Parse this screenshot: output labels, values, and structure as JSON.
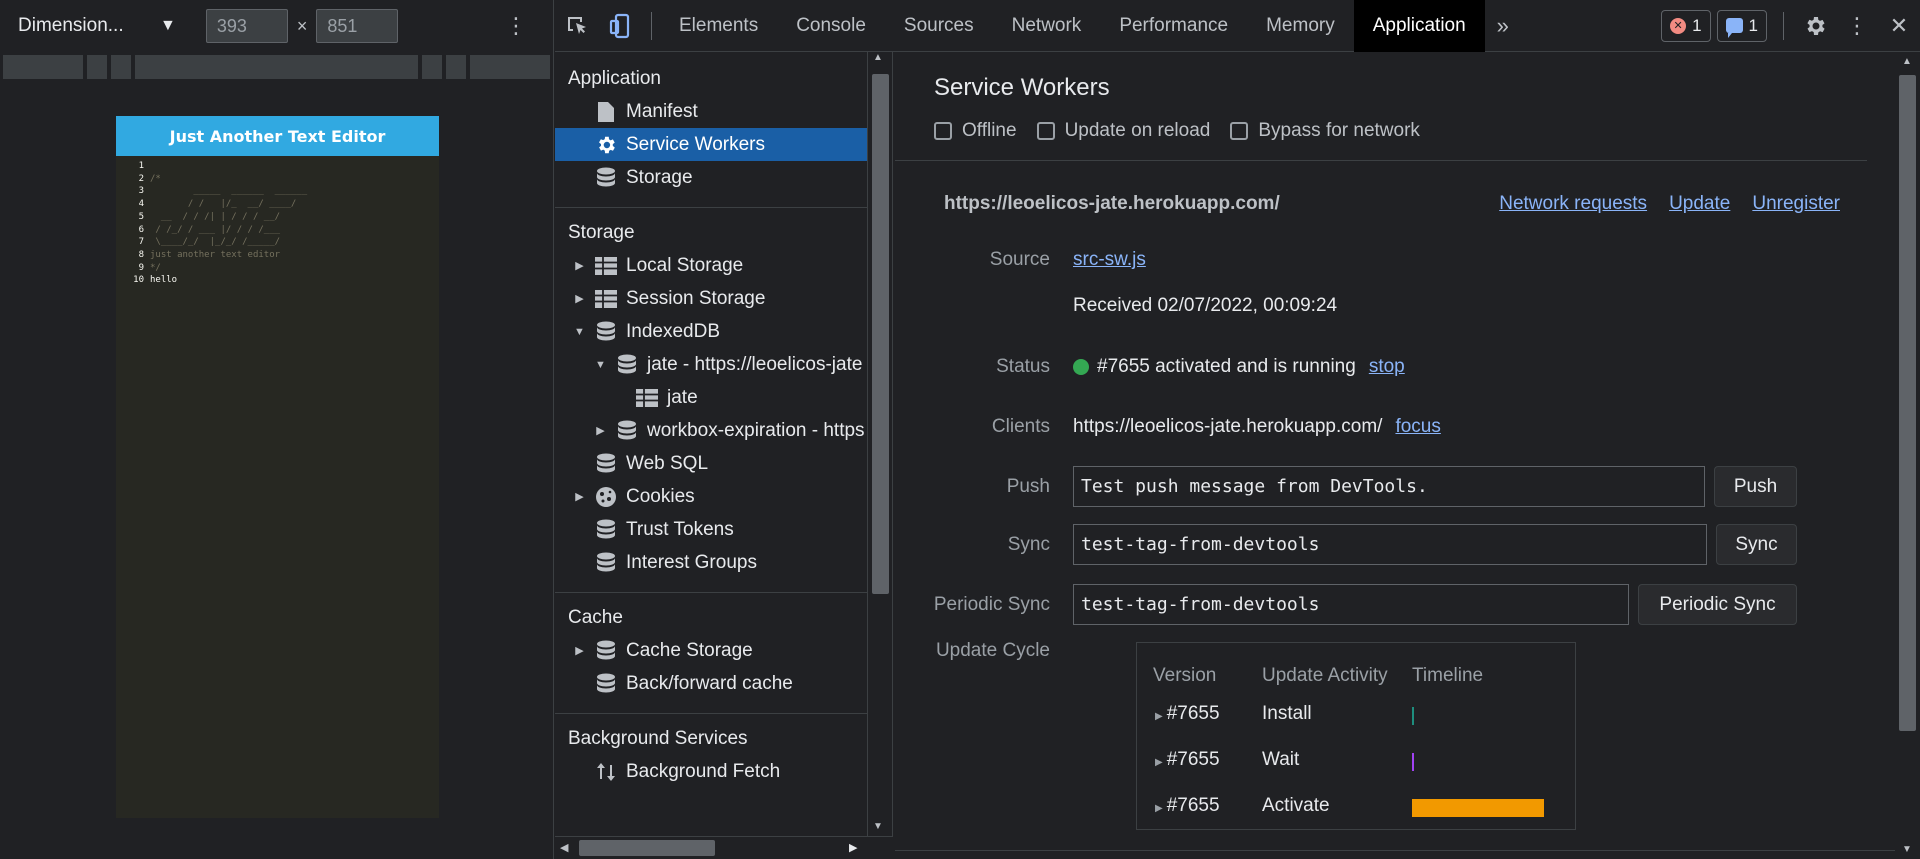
{
  "device": {
    "dimension_label": "Dimension...",
    "width": "393",
    "height": "851",
    "times": "×",
    "editor_title": "Just Another Text Editor",
    "code": [
      {
        "n": "1",
        "t": ""
      },
      {
        "n": "2",
        "t": "/*"
      },
      {
        "n": "3",
        "t": "        _____  ______  ______"
      },
      {
        "n": "4",
        "t": "       / /   |/_  __/ ____/"
      },
      {
        "n": "5",
        "t": "  __  / / /| | / / / __/"
      },
      {
        "n": "6",
        "t": " / /_/ / ___ |/ / / /___"
      },
      {
        "n": "7",
        "t": " \\____/_/  |_/_/ /_____/"
      },
      {
        "n": "8",
        "t": "just another text editor"
      },
      {
        "n": "9",
        "t": "*/"
      },
      {
        "n": "10",
        "t": "hello"
      }
    ]
  },
  "tabs": [
    "Elements",
    "Console",
    "Sources",
    "Network",
    "Performance",
    "Memory",
    "Application"
  ],
  "active_tab": "Application",
  "badges": {
    "errors": "1",
    "messages": "1"
  },
  "sidebar": {
    "application_title": "Application",
    "application_items": [
      "Manifest",
      "Service Workers",
      "Storage"
    ],
    "storage_title": "Storage",
    "storage_items": [
      "Local Storage",
      "Session Storage",
      "IndexedDB",
      "jate - https://leoelicos-jate",
      "jate",
      "workbox-expiration - https",
      "Web SQL",
      "Cookies",
      "Trust Tokens",
      "Interest Groups"
    ],
    "cache_title": "Cache",
    "cache_items": [
      "Cache Storage",
      "Back/forward cache"
    ],
    "bg_title": "Background Services",
    "bg_items": [
      "Background Fetch"
    ]
  },
  "main": {
    "title": "Service Workers",
    "options": [
      "Offline",
      "Update on reload",
      "Bypass for network"
    ],
    "sw_url": "https://leoelicos-jate.herokuapp.com/",
    "links": [
      "Network requests",
      "Update",
      "Unregister"
    ],
    "source_label": "Source",
    "source_link": "src-sw.js",
    "received": "Received 02/07/2022, 00:09:24",
    "status_label": "Status",
    "status_text": "#7655 activated and is running",
    "status_link": "stop",
    "clients_label": "Clients",
    "clients_url": "https://leoelicos-jate.herokuapp.com/",
    "clients_link": "focus",
    "push_label": "Push",
    "push_value": "Test push message from DevTools.",
    "push_button": "Push",
    "sync_label": "Sync",
    "sync_value": "test-tag-from-devtools",
    "sync_button": "Sync",
    "periodic_label": "Periodic Sync",
    "periodic_value": "test-tag-from-devtools",
    "periodic_button": "Periodic Sync",
    "cycle_label": "Update Cycle",
    "cycle_headers": [
      "Version",
      "Update Activity",
      "Timeline"
    ],
    "cycle_rows": [
      {
        "version": "#7655",
        "activity": "Install"
      },
      {
        "version": "#7655",
        "activity": "Wait"
      },
      {
        "version": "#7655",
        "activity": "Activate"
      }
    ]
  },
  "colors": {
    "selected": "#1a5fa6",
    "link": "#8ab4f8",
    "running": "#34a853",
    "activate_bar": "#f29900"
  }
}
